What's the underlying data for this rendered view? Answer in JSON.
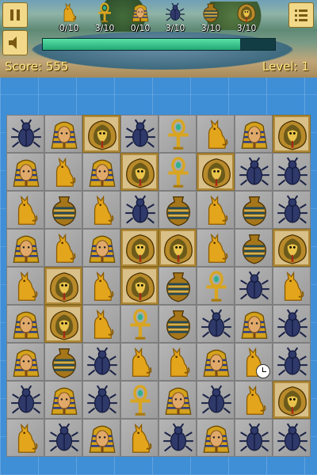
{
  "hud": {
    "score_label": "Score: 555",
    "level_label": "Level: 1",
    "progress_fraction": 0.85,
    "goals": [
      {
        "icon": "cat-icon",
        "count": "0/10"
      },
      {
        "icon": "ankh-icon",
        "count": "3/10"
      },
      {
        "icon": "pharaoh-icon",
        "count": "0/10"
      },
      {
        "icon": "scarab-icon",
        "count": "3/10"
      },
      {
        "icon": "vase-icon",
        "count": "3/10"
      },
      {
        "icon": "cobra-icon",
        "count": "3/10"
      }
    ],
    "buttons": [
      "pause-icon",
      "sound-icon",
      "menu-icon"
    ]
  },
  "board": {
    "columns": 8,
    "rows": [
      [
        "scarab",
        "pharaoh",
        "cobra",
        "scarab",
        "ankh",
        "cat",
        "pharaoh",
        "cobra"
      ],
      [
        "pharaoh",
        "cat",
        "pharaoh",
        "cobra",
        "ankh",
        "cobra",
        "scarab",
        "scarab"
      ],
      [
        "cat",
        "vase",
        "cat",
        "scarab",
        "vase",
        "cat",
        "vase",
        "scarab"
      ],
      [
        "pharaoh",
        "cat",
        "pharaoh",
        "cobra",
        "cobra",
        "cat",
        "vase",
        "cobra"
      ],
      [
        "cat",
        "cobra",
        "cat",
        "cobra",
        "vase",
        "ankh",
        "scarab",
        "cat"
      ],
      [
        "pharaoh",
        "cobra",
        "cat",
        "ankh",
        "vase",
        "scarab",
        "pharaoh",
        "scarab"
      ],
      [
        "pharaoh",
        "vase",
        "scarab",
        "cat",
        "cat",
        "pharaoh",
        "cat",
        "scarab"
      ],
      [
        "scarab",
        "pharaoh",
        "scarab",
        "ankh",
        "pharaoh",
        "scarab",
        "cat",
        "cobra"
      ],
      [
        "cat",
        "scarab",
        "pharaoh",
        "cat",
        "scarab",
        "pharaoh",
        "scarab",
        "scarab"
      ]
    ],
    "bonus_clock_cell": {
      "row": 6,
      "col": 6,
      "icon": "clock-icon"
    }
  }
}
